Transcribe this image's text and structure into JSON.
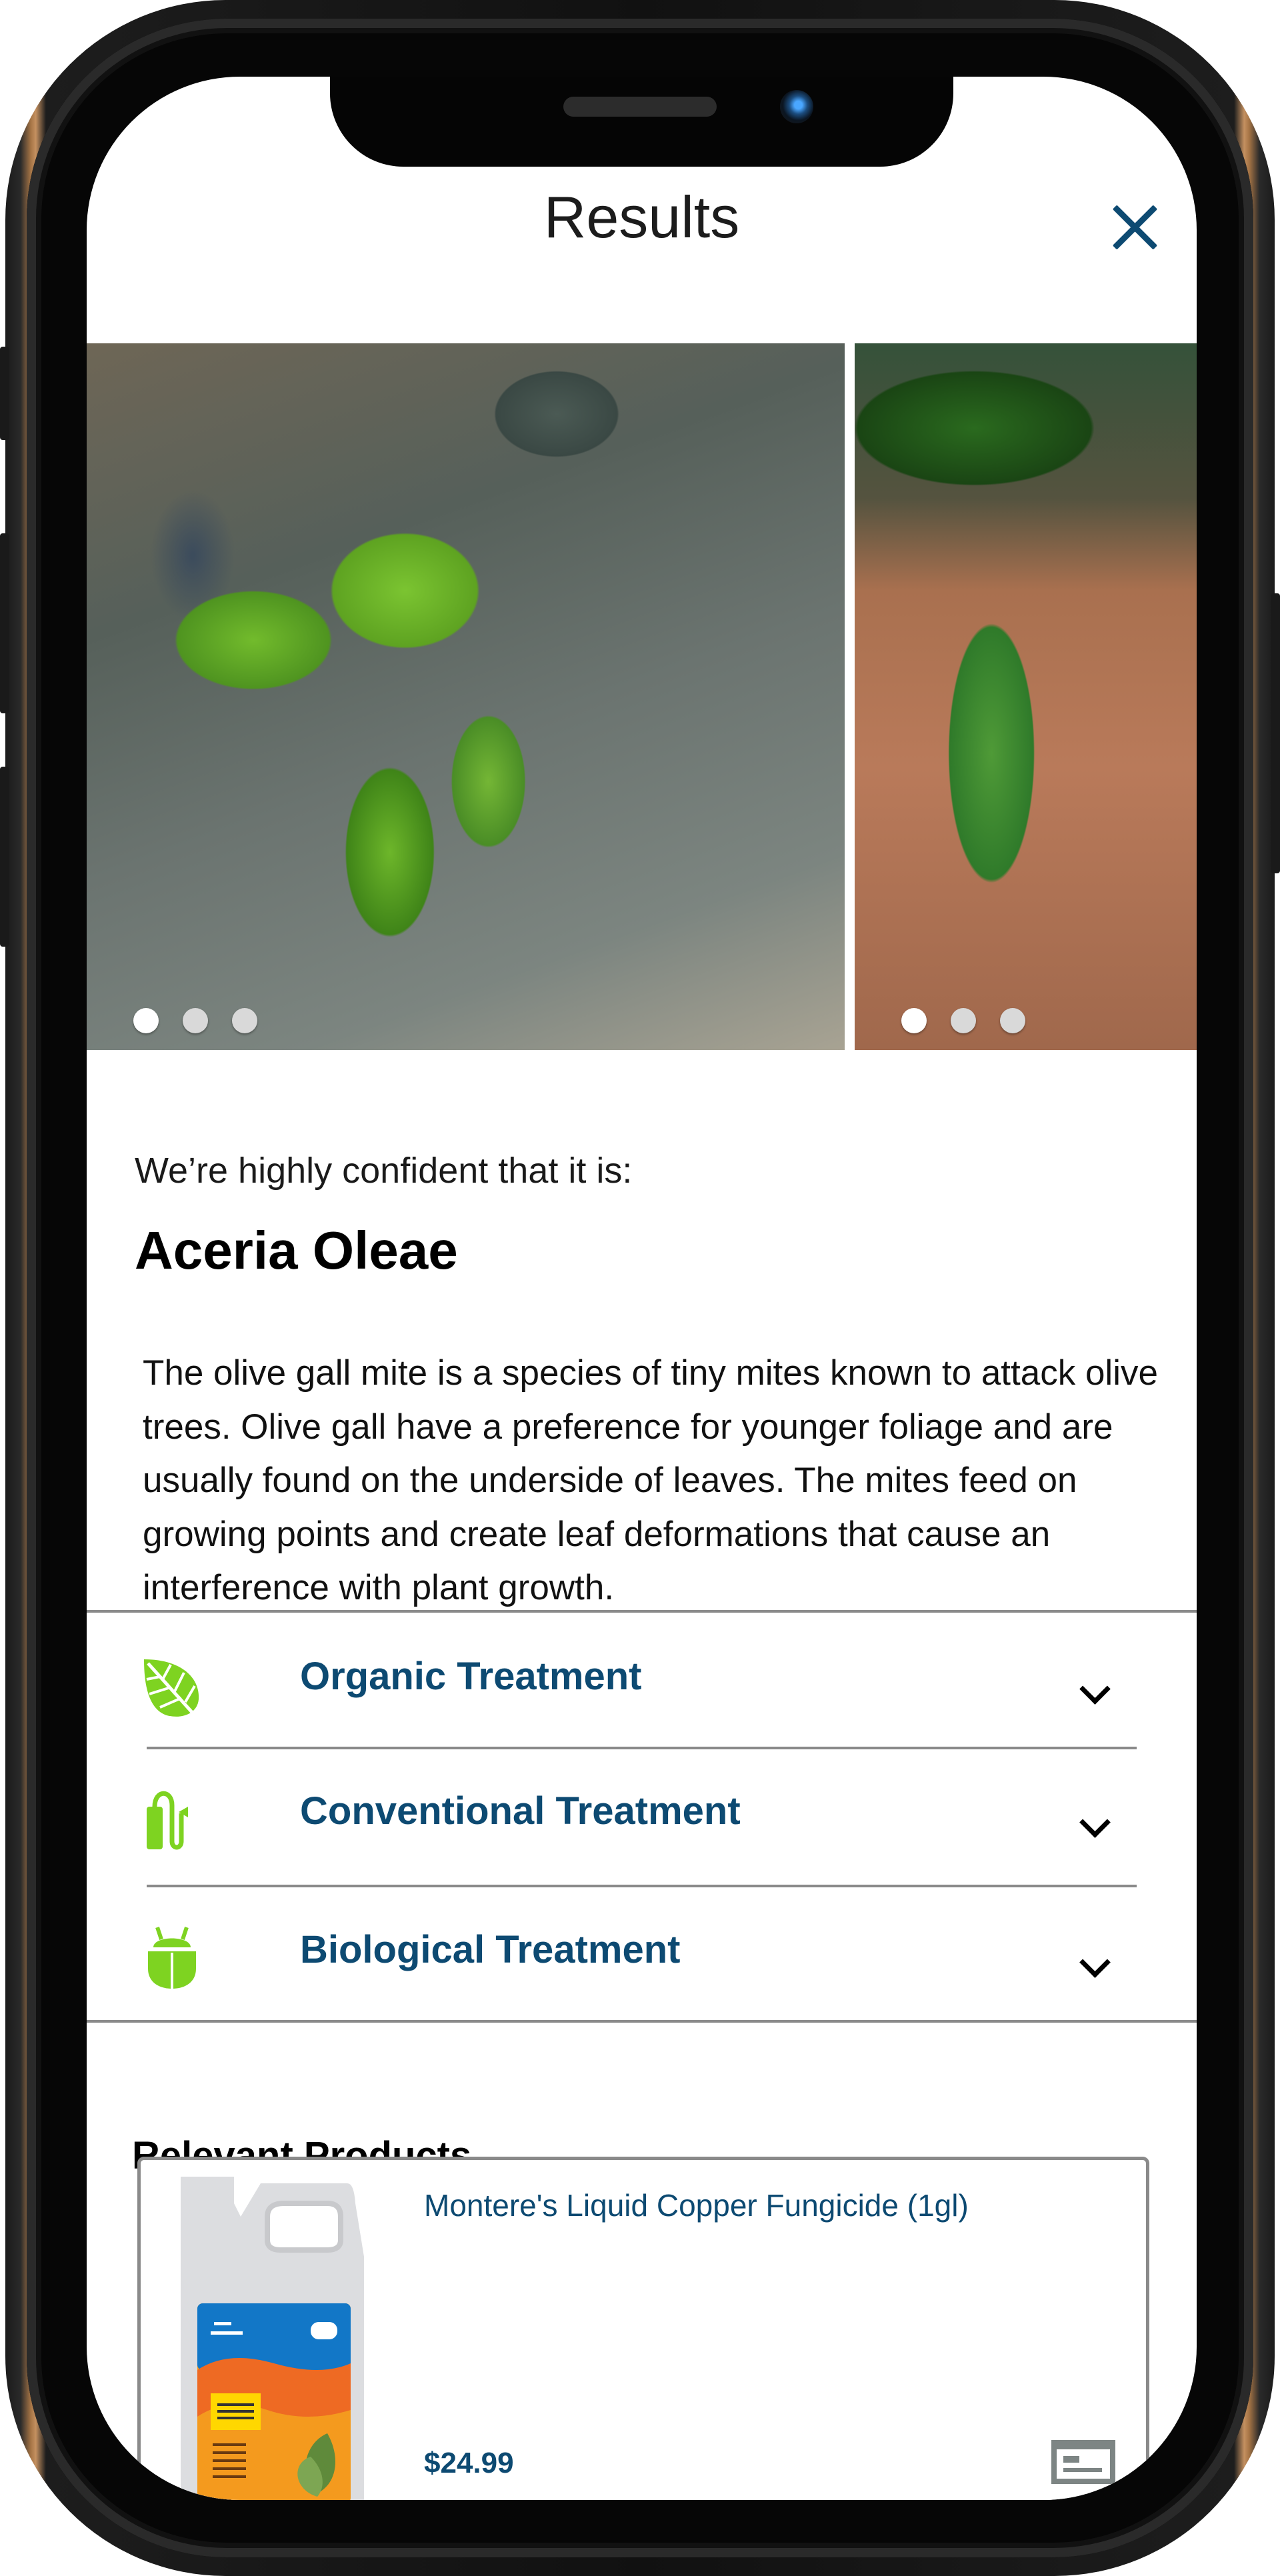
{
  "header": {
    "title": "Results",
    "close_icon": "close-icon"
  },
  "carousel": {
    "photos": [
      {
        "description": "olive leaves close-up",
        "dots": 3,
        "active_dot": 0
      },
      {
        "description": "olive leaf held in hand",
        "dots": 3,
        "active_dot": 0
      }
    ]
  },
  "result": {
    "confidence_text": "We’re highly confident that it is:",
    "species": "Aceria Oleae",
    "description": "The olive gall mite is a species of tiny mites known to attack olive trees. Olive gall have a preference for younger foliage and are usually found on the underside of leaves. The mites feed on growing points and create leaf deformations that cause an interference with plant growth."
  },
  "treatments": [
    {
      "label": "Organic Treatment",
      "icon": "leaf-icon"
    },
    {
      "label": "Conventional Treatment",
      "icon": "sprayer-icon"
    },
    {
      "label": "Biological Treatment",
      "icon": "bug-icon"
    }
  ],
  "products": {
    "title": "Relevant Products",
    "items": [
      {
        "name": "Montere's Liquid Copper Fungicide (1gl)",
        "price": "$24.99",
        "icon": "details-icon"
      }
    ]
  },
  "colors": {
    "accent": "#0d4a72",
    "icon_green": "#7ed321",
    "divider": "#8a8a8a"
  }
}
